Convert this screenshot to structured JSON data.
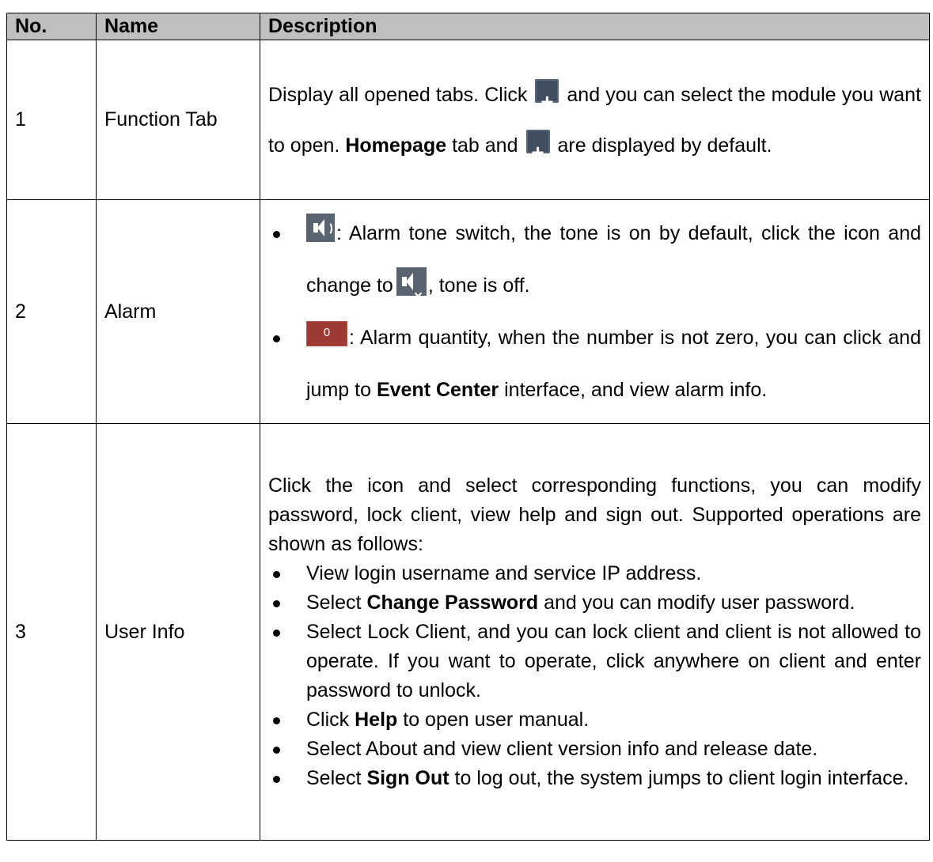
{
  "table": {
    "headers": {
      "no": "No.",
      "name": "Name",
      "description": "Description"
    },
    "rows": [
      {
        "no": "1",
        "name": "Function Tab",
        "desc_a": "Display all opened tabs. Click",
        "desc_b": "and you can select the module you want to open.",
        "bold1": "Homepage",
        "desc_c": "tab and",
        "desc_d": "are displayed by default.",
        "icon": "plus-icon"
      },
      {
        "no": "2",
        "name": "Alarm",
        "b1_a": ": Alarm tone switch, the tone is on by default, click the icon and change to",
        "b1_b": ", tone is off.",
        "b2_badge": "0",
        "b2_a": ": Alarm quantity, when the number is not zero, you can click and jump to",
        "b2_bold": "Event Center",
        "b2_b": "interface, and view alarm info.",
        "icons": [
          "speaker-icon",
          "mute-icon"
        ]
      },
      {
        "no": "3",
        "name": "User Info",
        "intro": "Click the icon and select corresponding functions, you can modify password, lock client, view help and sign out. Supported operations are shown as follows:",
        "b1": "View login username and service IP address.",
        "b2_a": "Select",
        "b2_bold": "Change Password",
        "b2_b": "and you can modify user password.",
        "b3": "Select Lock Client, and you can lock client and client is not allowed to operate. If you want to operate, click anywhere on client and enter password to unlock.",
        "b4_a": "Click",
        "b4_bold": "Help",
        "b4_b": "to open user manual.",
        "b5": "Select About and view client version info and release date.",
        "b6_a": "Select",
        "b6_bold": "Sign Out",
        "b6_b": "to log out, the system jumps to client login interface."
      }
    ]
  }
}
